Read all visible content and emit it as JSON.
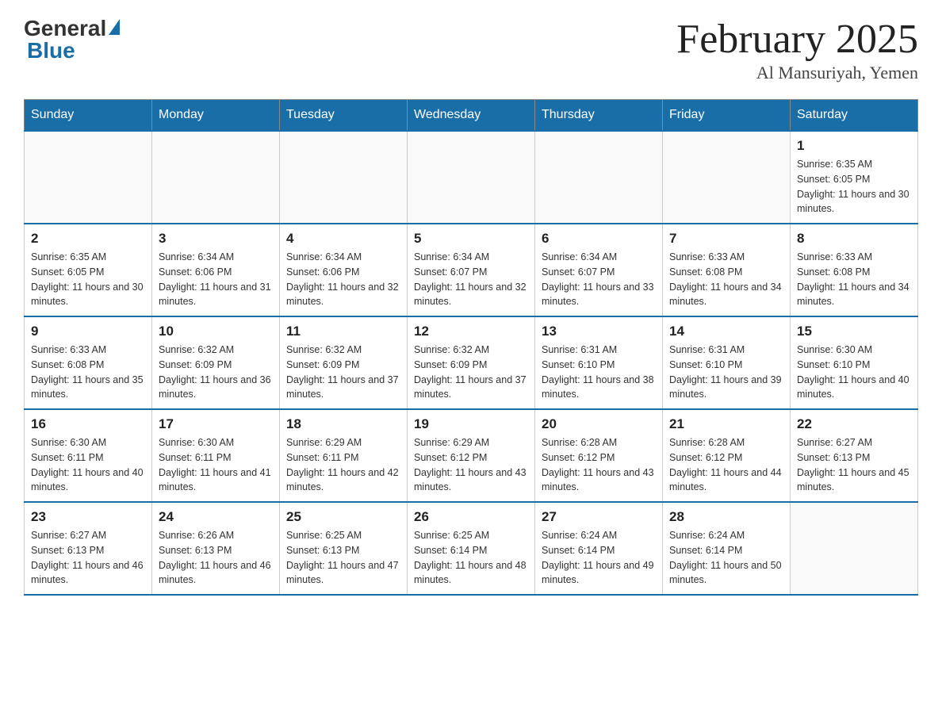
{
  "logo": {
    "general": "General",
    "blue": "Blue"
  },
  "title": "February 2025",
  "location": "Al Mansuriyah, Yemen",
  "days_of_week": [
    "Sunday",
    "Monday",
    "Tuesday",
    "Wednesday",
    "Thursday",
    "Friday",
    "Saturday"
  ],
  "weeks": [
    [
      {
        "day": "",
        "info": ""
      },
      {
        "day": "",
        "info": ""
      },
      {
        "day": "",
        "info": ""
      },
      {
        "day": "",
        "info": ""
      },
      {
        "day": "",
        "info": ""
      },
      {
        "day": "",
        "info": ""
      },
      {
        "day": "1",
        "info": "Sunrise: 6:35 AM\nSunset: 6:05 PM\nDaylight: 11 hours and 30 minutes."
      }
    ],
    [
      {
        "day": "2",
        "info": "Sunrise: 6:35 AM\nSunset: 6:05 PM\nDaylight: 11 hours and 30 minutes."
      },
      {
        "day": "3",
        "info": "Sunrise: 6:34 AM\nSunset: 6:06 PM\nDaylight: 11 hours and 31 minutes."
      },
      {
        "day": "4",
        "info": "Sunrise: 6:34 AM\nSunset: 6:06 PM\nDaylight: 11 hours and 32 minutes."
      },
      {
        "day": "5",
        "info": "Sunrise: 6:34 AM\nSunset: 6:07 PM\nDaylight: 11 hours and 32 minutes."
      },
      {
        "day": "6",
        "info": "Sunrise: 6:34 AM\nSunset: 6:07 PM\nDaylight: 11 hours and 33 minutes."
      },
      {
        "day": "7",
        "info": "Sunrise: 6:33 AM\nSunset: 6:08 PM\nDaylight: 11 hours and 34 minutes."
      },
      {
        "day": "8",
        "info": "Sunrise: 6:33 AM\nSunset: 6:08 PM\nDaylight: 11 hours and 34 minutes."
      }
    ],
    [
      {
        "day": "9",
        "info": "Sunrise: 6:33 AM\nSunset: 6:08 PM\nDaylight: 11 hours and 35 minutes."
      },
      {
        "day": "10",
        "info": "Sunrise: 6:32 AM\nSunset: 6:09 PM\nDaylight: 11 hours and 36 minutes."
      },
      {
        "day": "11",
        "info": "Sunrise: 6:32 AM\nSunset: 6:09 PM\nDaylight: 11 hours and 37 minutes."
      },
      {
        "day": "12",
        "info": "Sunrise: 6:32 AM\nSunset: 6:09 PM\nDaylight: 11 hours and 37 minutes."
      },
      {
        "day": "13",
        "info": "Sunrise: 6:31 AM\nSunset: 6:10 PM\nDaylight: 11 hours and 38 minutes."
      },
      {
        "day": "14",
        "info": "Sunrise: 6:31 AM\nSunset: 6:10 PM\nDaylight: 11 hours and 39 minutes."
      },
      {
        "day": "15",
        "info": "Sunrise: 6:30 AM\nSunset: 6:10 PM\nDaylight: 11 hours and 40 minutes."
      }
    ],
    [
      {
        "day": "16",
        "info": "Sunrise: 6:30 AM\nSunset: 6:11 PM\nDaylight: 11 hours and 40 minutes."
      },
      {
        "day": "17",
        "info": "Sunrise: 6:30 AM\nSunset: 6:11 PM\nDaylight: 11 hours and 41 minutes."
      },
      {
        "day": "18",
        "info": "Sunrise: 6:29 AM\nSunset: 6:11 PM\nDaylight: 11 hours and 42 minutes."
      },
      {
        "day": "19",
        "info": "Sunrise: 6:29 AM\nSunset: 6:12 PM\nDaylight: 11 hours and 43 minutes."
      },
      {
        "day": "20",
        "info": "Sunrise: 6:28 AM\nSunset: 6:12 PM\nDaylight: 11 hours and 43 minutes."
      },
      {
        "day": "21",
        "info": "Sunrise: 6:28 AM\nSunset: 6:12 PM\nDaylight: 11 hours and 44 minutes."
      },
      {
        "day": "22",
        "info": "Sunrise: 6:27 AM\nSunset: 6:13 PM\nDaylight: 11 hours and 45 minutes."
      }
    ],
    [
      {
        "day": "23",
        "info": "Sunrise: 6:27 AM\nSunset: 6:13 PM\nDaylight: 11 hours and 46 minutes."
      },
      {
        "day": "24",
        "info": "Sunrise: 6:26 AM\nSunset: 6:13 PM\nDaylight: 11 hours and 46 minutes."
      },
      {
        "day": "25",
        "info": "Sunrise: 6:25 AM\nSunset: 6:13 PM\nDaylight: 11 hours and 47 minutes."
      },
      {
        "day": "26",
        "info": "Sunrise: 6:25 AM\nSunset: 6:14 PM\nDaylight: 11 hours and 48 minutes."
      },
      {
        "day": "27",
        "info": "Sunrise: 6:24 AM\nSunset: 6:14 PM\nDaylight: 11 hours and 49 minutes."
      },
      {
        "day": "28",
        "info": "Sunrise: 6:24 AM\nSunset: 6:14 PM\nDaylight: 11 hours and 50 minutes."
      },
      {
        "day": "",
        "info": ""
      }
    ]
  ]
}
